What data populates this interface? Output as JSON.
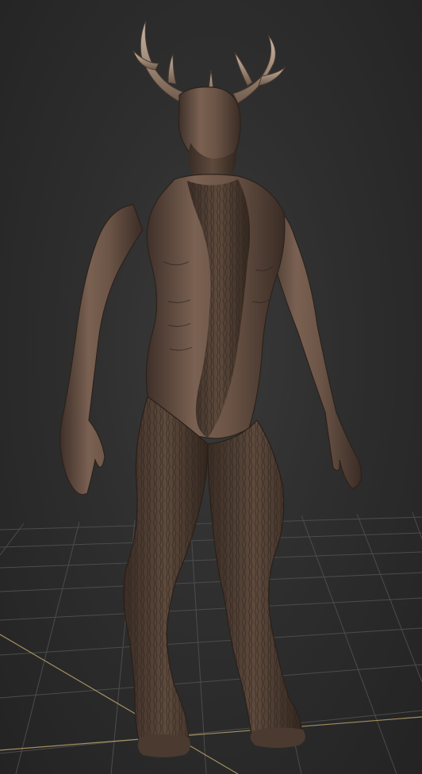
{
  "viewport": {
    "kind": "3d-viewport",
    "background_color": "#2d2d2d",
    "grid_color": "#4a4a4a",
    "grid_axis_color": "#b8a26a",
    "model": {
      "name_icon": "creature-sculpt-model",
      "surface_color": "#6b5446"
    }
  }
}
